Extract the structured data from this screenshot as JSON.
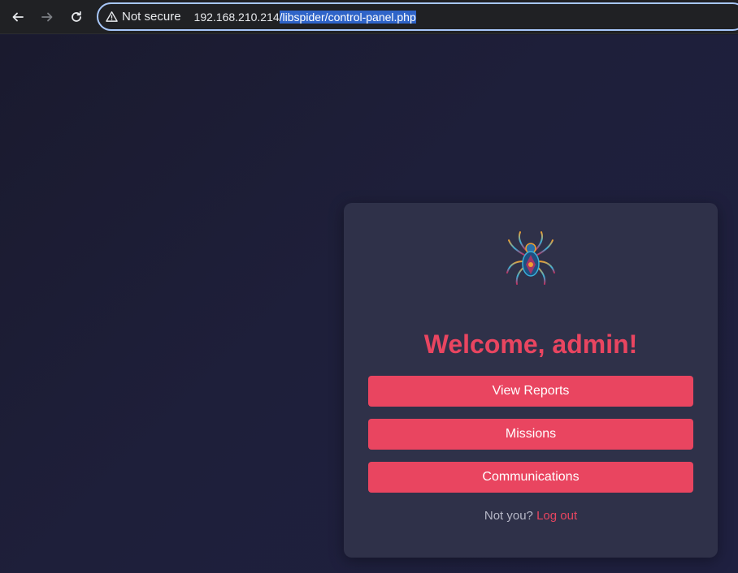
{
  "browser": {
    "security_label": "Not secure",
    "url_host": "192.168.210.214",
    "url_path": "/libspider/control-panel.php"
  },
  "panel": {
    "welcome": "Welcome, admin!",
    "buttons": [
      "View Reports",
      "Missions",
      "Communications"
    ],
    "footer_prefix": "Not you?",
    "logout_label": "Log out"
  },
  "colors": {
    "accent": "#e94560",
    "card": "#2f3149",
    "background": "#1c1d32"
  },
  "icons": [
    "back-arrow-icon",
    "forward-arrow-icon",
    "reload-icon",
    "warning-icon",
    "spider-logo-icon"
  ]
}
